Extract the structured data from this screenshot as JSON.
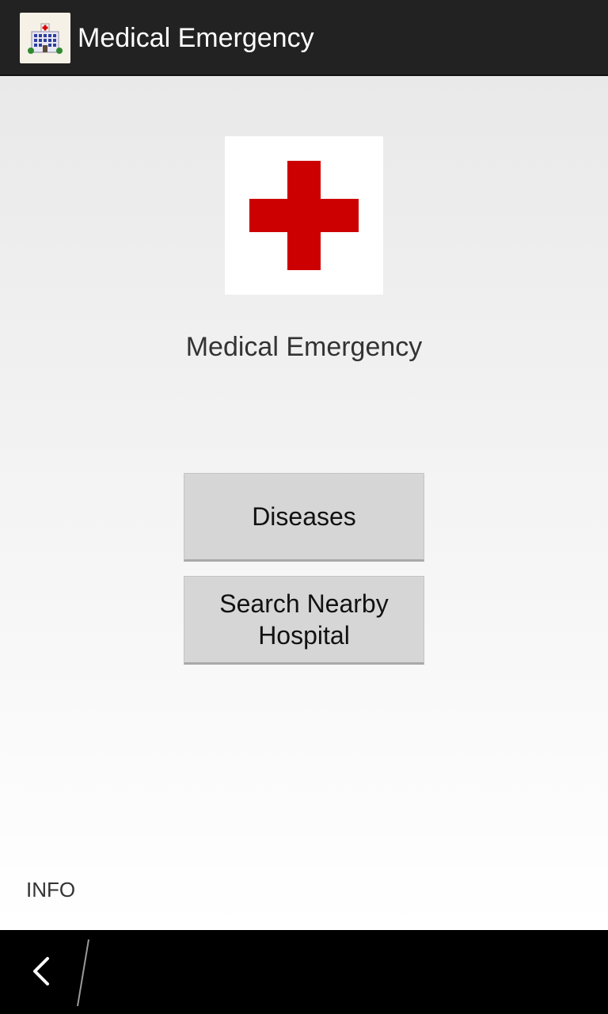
{
  "action_bar": {
    "title": "Medical Emergency",
    "icon": "hospital-building-icon"
  },
  "main": {
    "logo_icon": "red-cross-icon",
    "heading": "Medical Emergency",
    "buttons": {
      "diseases": "Diseases",
      "search_hospital": "Search Nearby Hospital"
    },
    "info_label": "INFO"
  },
  "nav_bar": {
    "back_icon": "back-chevron-icon"
  },
  "colors": {
    "action_bar_bg": "#222222",
    "cross_red": "#cc0000",
    "button_bg": "#d6d6d6"
  }
}
